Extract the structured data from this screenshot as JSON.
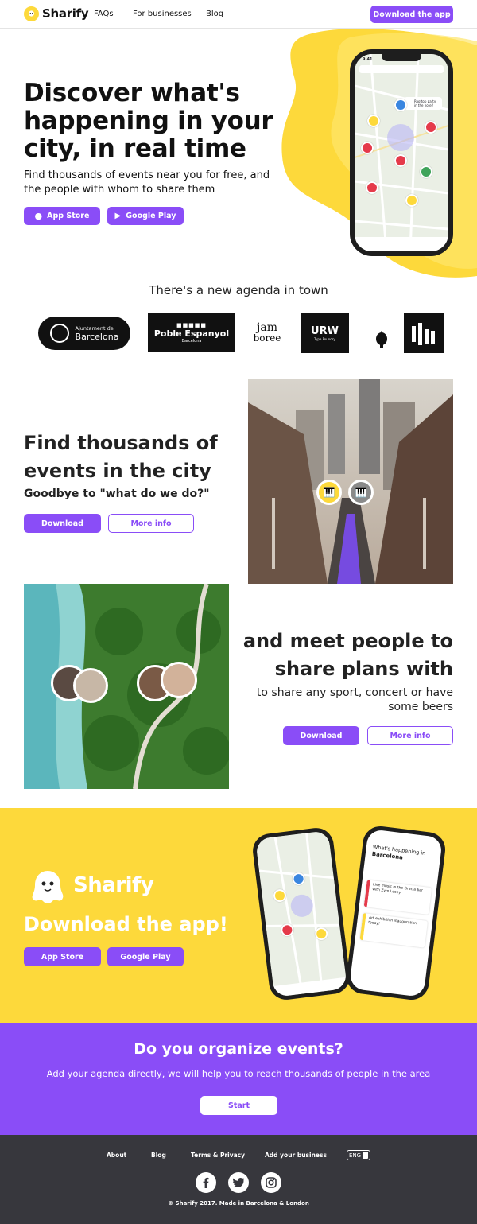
{
  "nav": {
    "brand": "Sharify",
    "links": [
      "FAQs",
      "For businesses",
      "Blog"
    ],
    "cta": "Download the app"
  },
  "hero": {
    "title": "Discover what's happening in your city, in real time",
    "subtitle": "Find thousands of events near you for free, and the people with whom to share them",
    "app_store": "App Store",
    "google_play": "Google Play",
    "phone_time": "9:41",
    "map_label": "Rooftop party in the hotel!"
  },
  "partners": {
    "heading": "There's a new agenda in town",
    "logos": [
      {
        "line1": "Ajuntament de",
        "line2": "Barcelona"
      },
      {
        "line1": "Poble Espanyol",
        "line2": "Barcelona"
      },
      {
        "line1": "jam",
        "line2": "boree"
      },
      {
        "line1": "URW",
        "line2": "Type Foundry"
      }
    ]
  },
  "feature1": {
    "title": "Find thousands of events in the city",
    "subtitle": "Goodbye to \"what do we do?\"",
    "download": "Download",
    "more": "More info"
  },
  "feature2": {
    "title": "and meet people to share plans with",
    "subtitle": "to share any sport, concert or have some beers",
    "download": "Download",
    "more": "More info"
  },
  "download": {
    "brand": "Sharify",
    "title": "Download the app!",
    "app_store": "App Store",
    "google_play": "Google Play",
    "phone2_heading": "What's happening in",
    "phone2_city": "Barcelona",
    "event1": "Live music in the Gracia bar with Zym Loony",
    "event2": "Art exhibition inauguration today!"
  },
  "organize": {
    "title": "Do you organize events?",
    "subtitle": "Add your agenda directly, we will help you to reach thousands of people in the area",
    "cta": "Start"
  },
  "footer": {
    "links": [
      "About",
      "Blog",
      "Terms & Privacy",
      "Add your business"
    ],
    "language": "ENG",
    "copyright": "© Sharify 2017. Made in Barcelona & London"
  },
  "colors": {
    "purple": "#8a4df7",
    "yellow": "#fdd93b",
    "footer": "#37373d"
  }
}
